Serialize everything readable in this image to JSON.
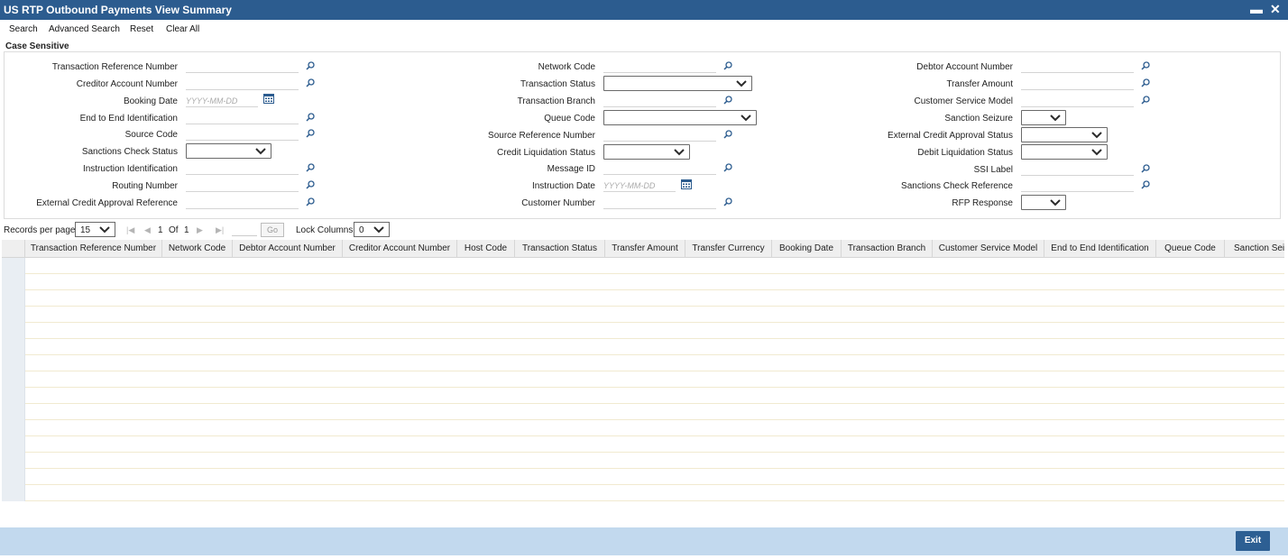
{
  "window": {
    "title": "US RTP Outbound Payments View Summary",
    "minimize_glyph": "▬",
    "close_glyph": "✕"
  },
  "toolbar": {
    "search": "Search",
    "advanced_search": "Advanced Search",
    "reset": "Reset",
    "clear_all": "Clear All"
  },
  "case_sensitive": "Case Sensitive",
  "fields": {
    "transaction_reference_number": "Transaction Reference Number",
    "creditor_account_number": "Creditor Account Number",
    "booking_date": "Booking Date",
    "booking_date_placeholder": "YYYY-MM-DD",
    "end_to_end_identification": "End to End Identification",
    "source_code": "Source Code",
    "sanctions_check_status": "Sanctions Check Status",
    "instruction_identification": "Instruction Identification",
    "routing_number": "Routing Number",
    "external_credit_approval_reference": "External Credit Approval Reference",
    "network_code": "Network Code",
    "transaction_status": "Transaction Status",
    "transaction_branch": "Transaction Branch",
    "queue_code": "Queue Code",
    "source_reference_number": "Source Reference Number",
    "credit_liquidation_status": "Credit Liquidation Status",
    "message_id": "Message ID",
    "instruction_date": "Instruction Date",
    "instruction_date_placeholder": "YYYY-MM-DD",
    "customer_number": "Customer Number",
    "debtor_account_number": "Debtor Account Number",
    "transfer_amount": "Transfer Amount",
    "customer_service_model": "Customer Service Model",
    "sanction_seizure": "Sanction Seizure",
    "external_credit_approval_status": "External Credit Approval Status",
    "debit_liquidation_status": "Debit Liquidation Status",
    "ssi_label": "SSI Label",
    "sanctions_check_reference": "Sanctions Check Reference",
    "rfp_response": "RFP Response"
  },
  "pager": {
    "records_per_page_label": "Records per page",
    "records_per_page_value": "15",
    "current_page": "1",
    "of_label": "Of",
    "total_pages": "1",
    "go_label": "Go",
    "lock_columns_label": "Lock Columns",
    "lock_columns_value": "0"
  },
  "grid": {
    "columns": [
      "Transaction Reference Number",
      "Network Code",
      "Debtor Account Number",
      "Creditor Account Number",
      "Host Code",
      "Transaction Status",
      "Transfer Amount",
      "Transfer Currency",
      "Booking Date",
      "Transaction Branch",
      "Customer Service Model",
      "End to End Identification",
      "Queue Code",
      "Sanction Sei"
    ],
    "row_count": 15
  },
  "footer": {
    "exit_label": "Exit"
  },
  "colors": {
    "titlebar": "#2c5c8f",
    "footer": "#c2d9ee",
    "button": "#2d5f93"
  },
  "icons": {
    "lookup": "magnifier-icon",
    "calendar": "calendar-icon",
    "dropdown": "chevron-down-icon"
  }
}
